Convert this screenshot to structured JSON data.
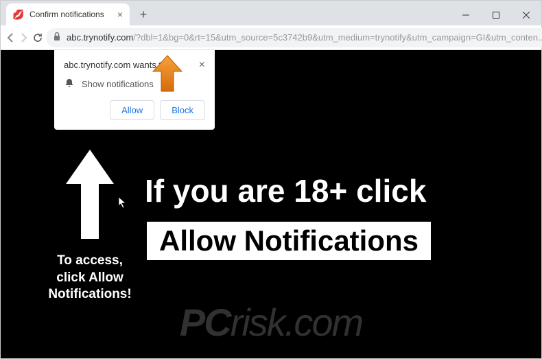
{
  "window": {
    "tab_title": "Confirm notifications",
    "favicon_glyph": "💋"
  },
  "toolbar": {
    "url_domain": "abc.trynotify.com",
    "url_path": "/?dbl=1&bg=0&rt=15&utm_source=5c3742b9&utm_medium=trynotify&utm_campaign=GI&utm_conten..."
  },
  "permission": {
    "origin": "abc.trynotify.com wants to",
    "message": "Show notifications",
    "allow": "Allow",
    "block": "Block"
  },
  "page": {
    "headline": "If you are 18+ click",
    "allow_label": "Allow Notifications",
    "arrow_caption": "To access, click Allow Notifications!"
  },
  "watermark": {
    "brand_prefix": "PC",
    "brand_suffix": "risk.com"
  },
  "colors": {
    "pointer_arrow": "#e8801a",
    "link_blue": "#1a73e8"
  }
}
